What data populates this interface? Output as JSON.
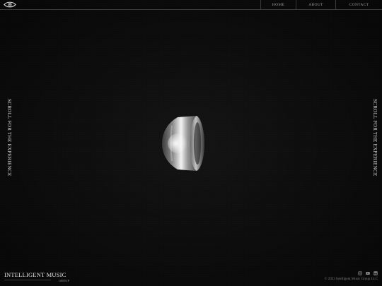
{
  "header": {
    "logo_icon": "eye-icon",
    "nav": [
      {
        "label": "HOME"
      },
      {
        "label": "ABOUT"
      },
      {
        "label": "CONTACT"
      }
    ]
  },
  "side_text": {
    "left": "SCROLL FOR THE EXPERIENCE",
    "right": "SCROLL FOR THE EXPERIENCE"
  },
  "footer": {
    "brand_name": "INTELLIGENT MUSIC",
    "brand_sub": "GROUP",
    "socials": [
      "instagram-icon",
      "youtube-icon",
      "linkedin-icon"
    ],
    "copyright": "© 2023 Intelligent Music Group LLC"
  },
  "colors": {
    "background": "#0b0b0b",
    "text": "#d8d8d8",
    "border": "#3a3a3a"
  }
}
